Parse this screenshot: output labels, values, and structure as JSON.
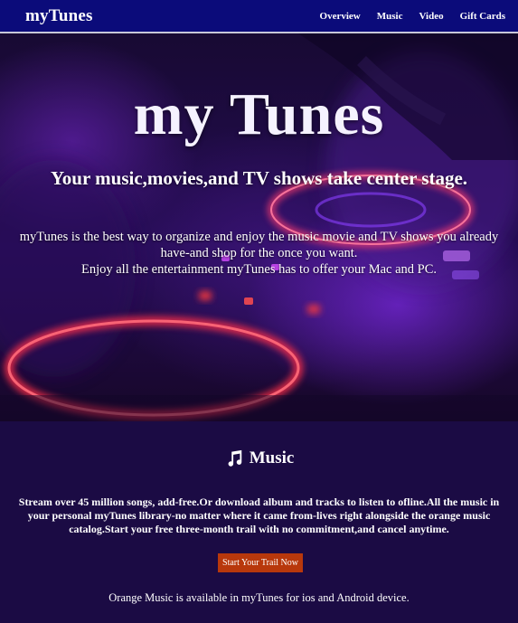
{
  "nav": {
    "brand": "myTunes",
    "links": [
      "Overview",
      "Music",
      "Video",
      "Gift Cards"
    ]
  },
  "hero": {
    "title": "my Tunes",
    "subtitle": "Your music,movies,and TV shows take center stage.",
    "description_line1": "myTunes is the best way to organize and enjoy the music movie and TV shows you already",
    "description_line2": "have-and shop for the once you want.",
    "description_line3": "Enjoy all the entertainment myTunes has to offer your Mac and PC."
  },
  "music": {
    "heading": "Music",
    "icon": "music-note-icon",
    "body": "Stream over 45 million songs, add-free.Or download album and tracks to listen to ofline.All the music in your personal myTunes library-no matter where it came from-lives right alongside the orange music catalog.Start your free three-month trail with no commitment,and cancel anytime.",
    "button_label": "Start Your Trail Now",
    "footer": "Orange Music is available in myTunes for ios and Android device."
  },
  "colors": {
    "nav_bg": "#0b0b7a",
    "page_bg": "#1b0b44",
    "button_bg": "#b8380c"
  }
}
